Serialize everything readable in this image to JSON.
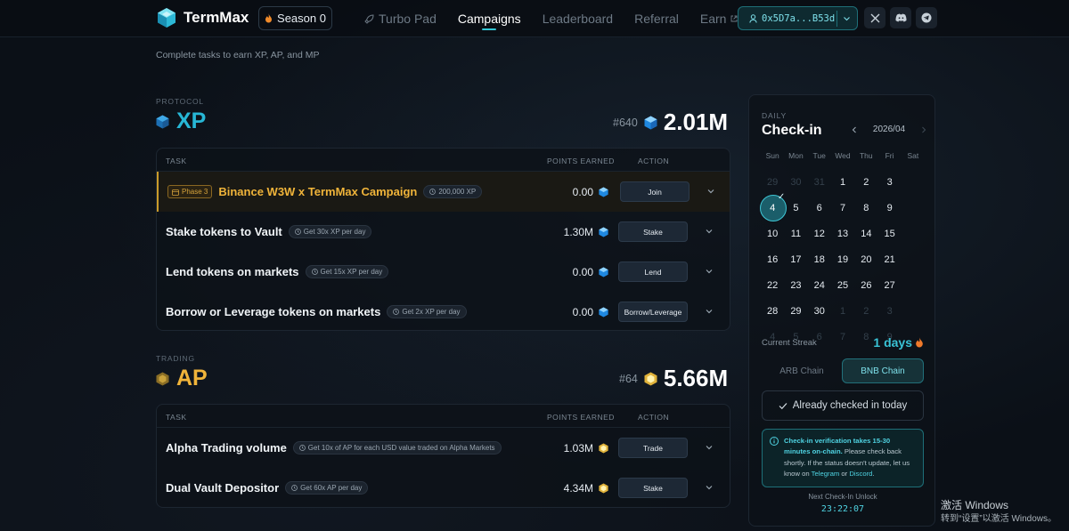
{
  "nav": {
    "logo_text": "TermMax",
    "season_label": "Season 0",
    "links": [
      "Turbo Pad",
      "Campaigns",
      "Leaderboard",
      "Referral",
      "Earn"
    ],
    "wallet": "0x5D7a...B53d"
  },
  "subtitle": "Complete tasks to earn XP, AP, and MP",
  "xp": {
    "section_label": "PROTOCOL",
    "title": "XP",
    "rank": "#640",
    "points": "2.01M",
    "headers": {
      "task": "TASK",
      "points": "POINTS EARNED",
      "action": "ACTION"
    },
    "rows": [
      {
        "phase": "Phase 3",
        "name": "Binance W3W x TermMax Campaign",
        "pill": "200,000 XP",
        "points": "0.00",
        "action": "Join"
      },
      {
        "name": "Stake tokens to Vault",
        "pill": "Get 30x XP per day",
        "points": "1.30M",
        "action": "Stake"
      },
      {
        "name": "Lend tokens on markets",
        "pill": "Get 15x XP per day",
        "points": "0.00",
        "action": "Lend"
      },
      {
        "name": "Borrow or Leverage tokens on markets",
        "pill": "Get 2x XP per day",
        "points": "0.00",
        "action": "Borrow/Leverage"
      }
    ]
  },
  "ap": {
    "section_label": "TRADING",
    "title": "AP",
    "rank": "#64",
    "points": "5.66M",
    "headers": {
      "task": "TASK",
      "points": "POINTS EARNED",
      "action": "ACTION"
    },
    "rows": [
      {
        "name": "Alpha Trading volume",
        "pill": "Get 10x of AP for each USD value traded on Alpha Markets",
        "points": "1.03M",
        "action": "Trade"
      },
      {
        "name": "Dual Vault Depositor",
        "pill": "Get 60x AP per day",
        "points": "4.34M",
        "action": "Stake"
      }
    ]
  },
  "checkin": {
    "label": "DAILY",
    "title": "Check-in",
    "month": "2026/04",
    "weekdays": [
      "Sun",
      "Mon",
      "Tue",
      "Wed",
      "Thu",
      "Fri",
      "Sat"
    ],
    "days": [
      {
        "d": "29",
        "dim": true
      },
      {
        "d": "30",
        "dim": true
      },
      {
        "d": "31",
        "dim": true
      },
      {
        "d": "1"
      },
      {
        "d": "2"
      },
      {
        "d": "3"
      },
      {
        "d": "4",
        "today": true
      },
      {
        "d": "5"
      },
      {
        "d": "6"
      },
      {
        "d": "7"
      },
      {
        "d": "8"
      },
      {
        "d": "9"
      },
      {
        "d": "10"
      },
      {
        "d": "11"
      },
      {
        "d": "12"
      },
      {
        "d": "13"
      },
      {
        "d": "14"
      },
      {
        "d": "15"
      },
      {
        "d": "16"
      },
      {
        "d": "17"
      },
      {
        "d": "18"
      },
      {
        "d": "19"
      },
      {
        "d": "20"
      },
      {
        "d": "21"
      },
      {
        "d": "22"
      },
      {
        "d": "23"
      },
      {
        "d": "24"
      },
      {
        "d": "25"
      },
      {
        "d": "26"
      },
      {
        "d": "27"
      },
      {
        "d": "28"
      },
      {
        "d": "29"
      },
      {
        "d": "30"
      },
      {
        "d": "1",
        "dim": true
      },
      {
        "d": "2",
        "dim": true
      },
      {
        "d": "3",
        "dim": true
      },
      {
        "d": "4",
        "dim": true
      },
      {
        "d": "5",
        "dim": true
      },
      {
        "d": "6",
        "dim": true
      },
      {
        "d": "7",
        "dim": true
      },
      {
        "d": "8",
        "dim": true
      },
      {
        "d": "9",
        "dim": true
      }
    ],
    "streak_label": "Current Streak",
    "streak_value": "1 days",
    "chains": [
      "ARB Chain",
      "BNB Chain"
    ],
    "status": "Already checked in today",
    "info_bold": "Check-in verification takes 15-30 minutes on-chain.",
    "info_text": " Please check back shortly. If the status doesn't update, let us know on ",
    "info_link1": "Telegram",
    "info_or": " or ",
    "info_link2": "Discord",
    "info_end": ".",
    "next_label": "Next Check-In Unlock",
    "timer": "23:22:07"
  },
  "watermark": {
    "line1": "激活 Windows",
    "line2": "转到“设置”以激活 Windows。"
  },
  "colors": {
    "accent": "#33c7d6",
    "xp": "#27b7d6",
    "ap": "#f0b43a",
    "bg": "#0b1017"
  }
}
